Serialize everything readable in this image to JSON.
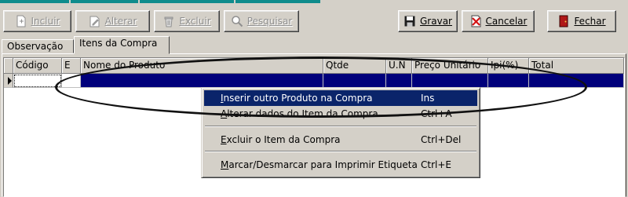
{
  "toolbar": {
    "incluir_label": "Incluir",
    "alterar_label": "Alterar",
    "excluir_label": "Excluir",
    "pesquisar_label": "Pesquisar",
    "gravar_label": "Gravar",
    "cancelar_label": "Cancelar",
    "fechar_label": "Fechar"
  },
  "tabs": [
    {
      "label": "Observação",
      "active": false
    },
    {
      "label": "Itens da Compra",
      "active": true
    }
  ],
  "grid": {
    "columns": [
      "Código",
      "E",
      "Nome do Produto",
      "Qtde",
      "U.N",
      "Preço Unitário",
      "Ipi(%)",
      "Total"
    ],
    "selected_row_color": "#00007b"
  },
  "context_menu": {
    "items": [
      {
        "label": "Inserir outro Produto na Compra",
        "shortcut": "Ins",
        "highlighted": true
      },
      {
        "label": "Alterar dados do Item da Compra",
        "shortcut": "Ctrl+A"
      },
      {
        "label": "Excluir o Item da Compra",
        "shortcut": "Ctrl+Del"
      },
      {
        "label": "Marcar/Desmarcar para Imprimir Etiqueta",
        "shortcut": "Ctrl+E"
      }
    ]
  },
  "colors": {
    "face": "#d4d0c8",
    "highlight": "#0a246a",
    "top_strip": "#0f8c8c"
  }
}
